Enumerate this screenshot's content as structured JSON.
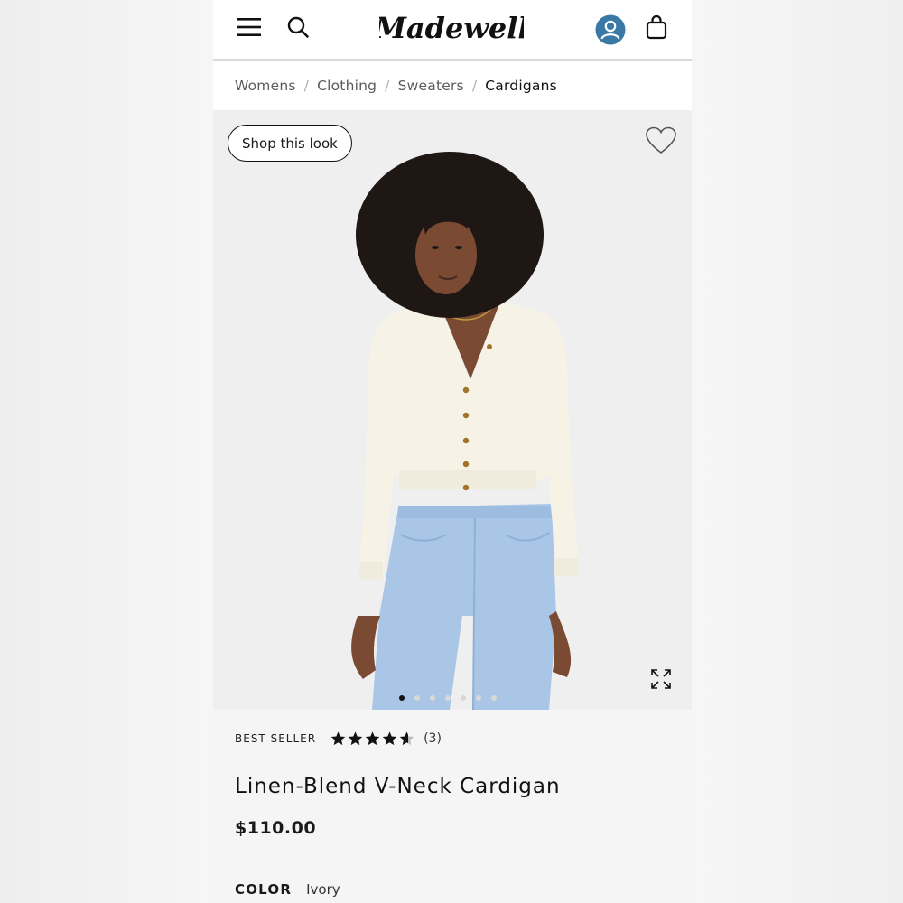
{
  "header": {
    "brand": "Madewell",
    "icons": {
      "menu": "hamburger-menu-icon",
      "search": "search-icon",
      "account": "account-icon",
      "bag": "shopping-bag-icon"
    },
    "account_color": "#3a79a6"
  },
  "breadcrumb": {
    "items": [
      "Womens",
      "Clothing",
      "Sweaters",
      "Cardigans"
    ],
    "separator": "/"
  },
  "gallery": {
    "shop_look_label": "Shop this look",
    "image_count": 7,
    "active_index": 0
  },
  "product": {
    "badge": "BEST SELLER",
    "rating": 4.5,
    "review_count": "(3)",
    "title": "Linen-Blend V-Neck Cardigan",
    "price": "$110.00",
    "color_label": "COLOR",
    "color_value": "Ivory"
  }
}
